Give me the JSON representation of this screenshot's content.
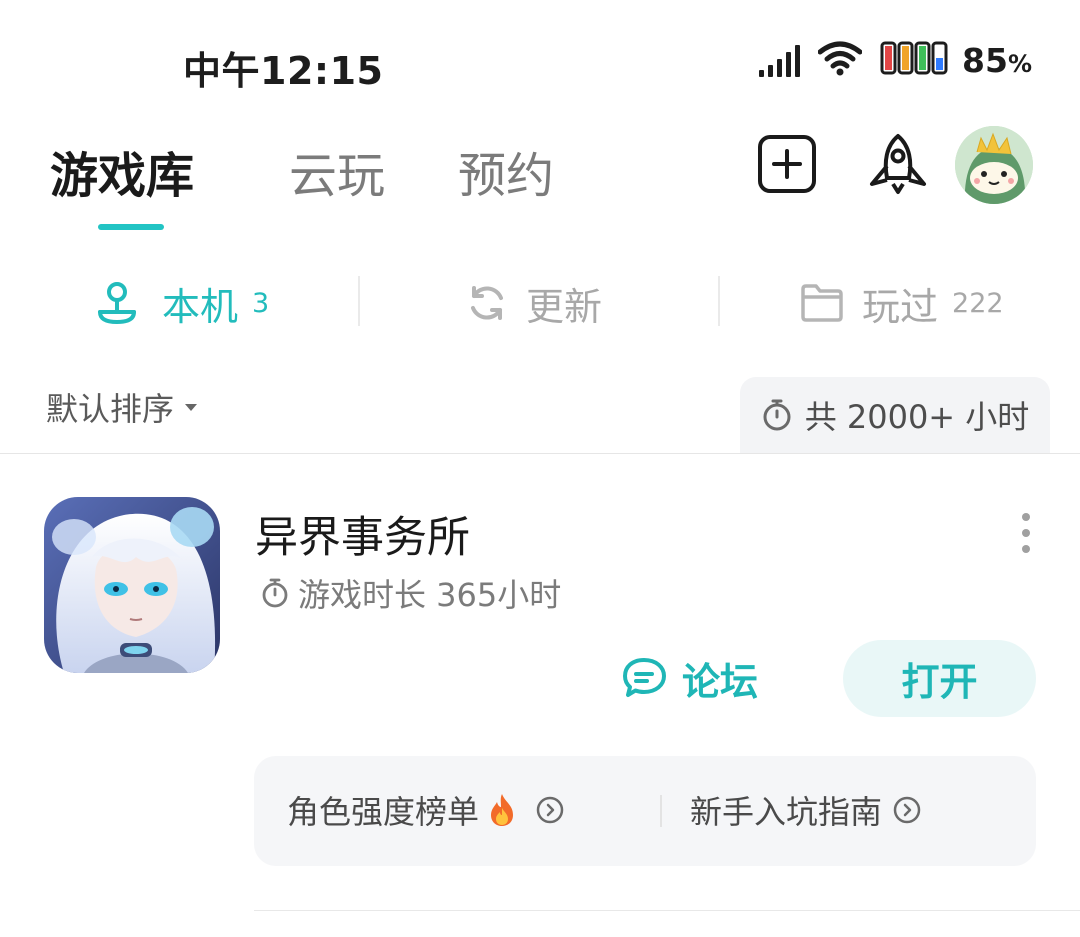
{
  "status_bar": {
    "time": "中午12:15",
    "battery_percent": "85",
    "battery_unit": "%",
    "icons": [
      "signal-icon",
      "wifi-icon",
      "battery-icon"
    ]
  },
  "header": {
    "tabs": [
      {
        "label": "游戏库",
        "active": true
      },
      {
        "label": "云玩",
        "active": false
      },
      {
        "label": "预约",
        "active": false
      }
    ],
    "accent_color": "#22c4c4",
    "actions": [
      "add-icon",
      "rocket-icon",
      "avatar"
    ]
  },
  "sub_tabs": {
    "local": {
      "label": "本机",
      "count": "3",
      "icon": "joystick-icon"
    },
    "update": {
      "label": "更新",
      "icon": "refresh-icon"
    },
    "played": {
      "label": "玩过",
      "count": "222",
      "icon": "folder-icon"
    }
  },
  "sort": {
    "label": "默认排序",
    "total_label": "共 2000+ 小时"
  },
  "games": [
    {
      "title": "异界事务所",
      "playtime": "游戏时长 365小时",
      "forum_label": "论坛",
      "open_label": "打开",
      "guides": [
        {
          "label": "角色强度榜单"
        },
        {
          "label": "新手入坑指南"
        }
      ]
    }
  ]
}
